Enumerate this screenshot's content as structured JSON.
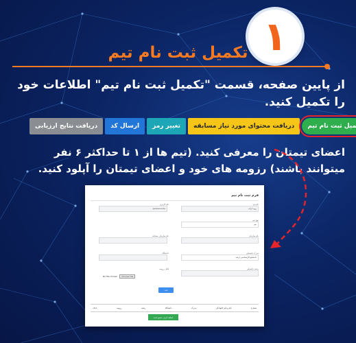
{
  "badge": {
    "number": "۱"
  },
  "title": "تکمیل ثبت نام تیم",
  "paragraph1": "از پایین صفحه، قسمت \"تکمیل ثبت نام تیم\" اطلاعات خود را تکمیل کنید.",
  "steps": [
    {
      "label": "تکمیل ثبت نام تیم",
      "color": "#2eae4d",
      "active": true
    },
    {
      "label": "دریافت محتوای مورد نیاز مسابقه",
      "color": "#f5c517"
    },
    {
      "label": "تغییر رمز",
      "color": "#1da6b5"
    },
    {
      "label": "ارسال کد",
      "color": "#2276d8"
    },
    {
      "label": "دریافت نتایج ارزیابی",
      "color": "#8a8d91"
    }
  ],
  "paragraph2": "اعضای تیمتان را معرفی کنید. (تیم ها از ۱ تا حداکثر ۶ نفر میتوانند باشند) رزومه های خود و اعضای تیمتان را آپلود کنید.",
  "form": {
    "title": "فرم ثبت نام تیم",
    "fields": {
      "f1_label": "نام تیم",
      "f1_value": "رویه ارائه",
      "f2_label": "نام کاربری",
      "f2_value": "persiancode",
      "f3_label": "نوع تیم",
      "f3_value": "تیم",
      "f4_label": "نام سازمان",
      "f5_label": "نام سازمان مسابقه",
      "f6_label": "مدرک تحصیلی",
      "f6_value": "دانشجو کارشناسی ارشد",
      "f7_label": "دانشگاه",
      "f8_label": "رشته تحصیلی",
      "f9_label": "فایل رزومه",
      "file_button": "Choose File",
      "file_none": "No file chosen"
    },
    "submit": "ثبت",
    "table_headers": [
      "شماره",
      "نام و نام خانوادگی",
      "مدرک",
      "دانشگاه",
      "رشته",
      "رزومه",
      "حذف"
    ],
    "add_member": "اضافه کردن عضو جدید"
  }
}
